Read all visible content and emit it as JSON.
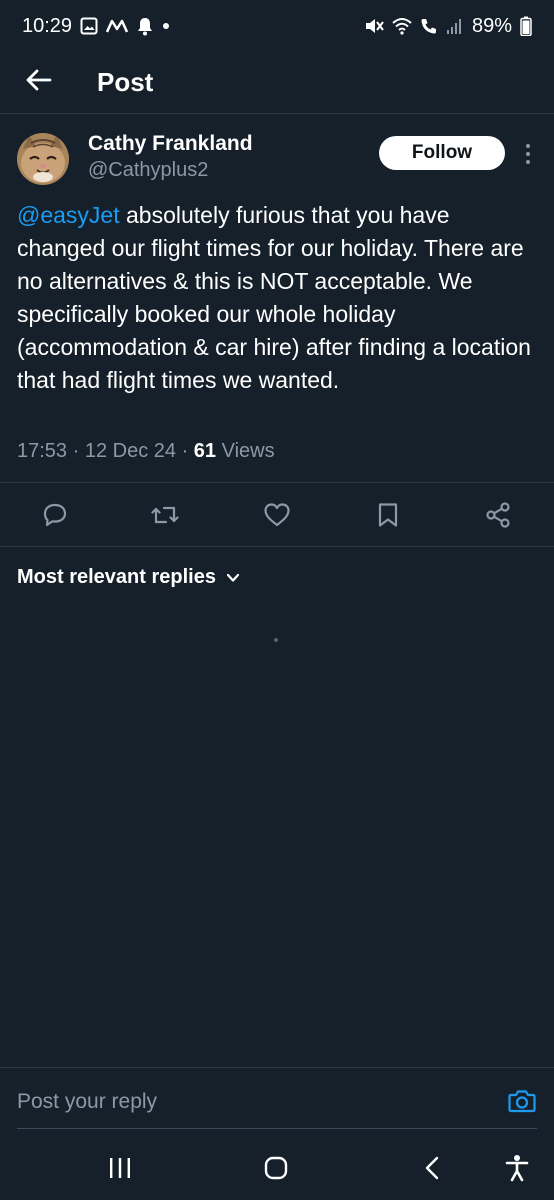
{
  "status_bar": {
    "time": "10:29",
    "battery_percent": "89%",
    "icons_left": [
      "gallery-icon",
      "signal-m-icon",
      "notification-bell-icon",
      "dot-icon"
    ],
    "icons_right": [
      "mute-icon",
      "wifi-icon",
      "wifi-call-icon",
      "signal-bars-icon",
      "battery-icon"
    ]
  },
  "header": {
    "title": "Post",
    "back_icon": "arrow-left-icon"
  },
  "post": {
    "author_name": "Cathy Frankland",
    "author_handle": "@Cathyplus2",
    "follow_label": "Follow",
    "mention": "@easyJet",
    "body": " absolutely furious that you have changed our flight times for our holiday. There are no alternatives & this is NOT acceptable. We specifically booked our whole holiday (accommodation & car hire) after finding a location that had flight times we wanted.",
    "time": "17:53",
    "date": "12 Dec 24",
    "views_count": "61",
    "views_label": "Views",
    "separator": " · "
  },
  "actions": [
    "reply-icon",
    "repost-icon",
    "like-icon",
    "bookmark-icon",
    "share-icon"
  ],
  "replies": {
    "sort_label": "Most relevant replies"
  },
  "reply_box": {
    "placeholder": "Post your reply"
  },
  "nav": [
    "recents-icon",
    "home-icon",
    "back-icon",
    "accessibility-icon"
  ],
  "colors": {
    "background": "#15202b",
    "accent": "#1d9bf0",
    "secondary_text": "#8b98a5"
  }
}
